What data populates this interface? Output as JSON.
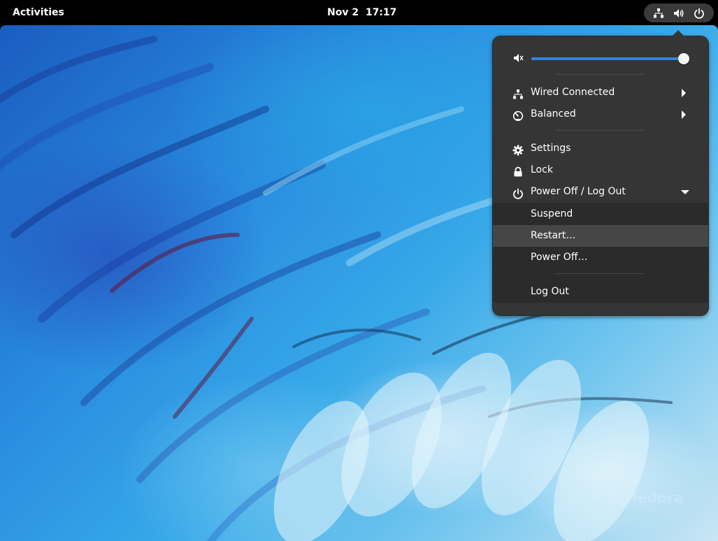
{
  "topbar": {
    "activities_label": "Activities",
    "clock": "Nov 2  17:17",
    "indicators": [
      "network-wired-icon",
      "volume-icon",
      "power-icon"
    ]
  },
  "wallpaper": {
    "watermark": "fedora"
  },
  "system_menu": {
    "volume": {
      "icon": "speaker-muted-icon",
      "level": 1.0
    },
    "items": [
      {
        "label": "Wired Connected",
        "icon": "network-wired-icon",
        "has_submenu": true
      },
      {
        "label": "Balanced",
        "icon": "power-profile-icon",
        "has_submenu": true
      },
      {
        "label": "Settings",
        "icon": "gear-icon",
        "has_submenu": false
      },
      {
        "label": "Lock",
        "icon": "lock-icon",
        "has_submenu": false
      },
      {
        "label": "Power Off / Log Out",
        "icon": "power-icon",
        "expanded": true
      }
    ],
    "power_submenu": [
      {
        "label": "Suspend"
      },
      {
        "label": "Restart…",
        "hovered": true
      },
      {
        "label": "Power Off…"
      },
      {
        "label": "Log Out"
      }
    ]
  },
  "colors": {
    "panel_bg": "#000000",
    "menu_bg": "#353535",
    "submenu_bg": "#2b2b2b",
    "accent": "#3584e4"
  }
}
